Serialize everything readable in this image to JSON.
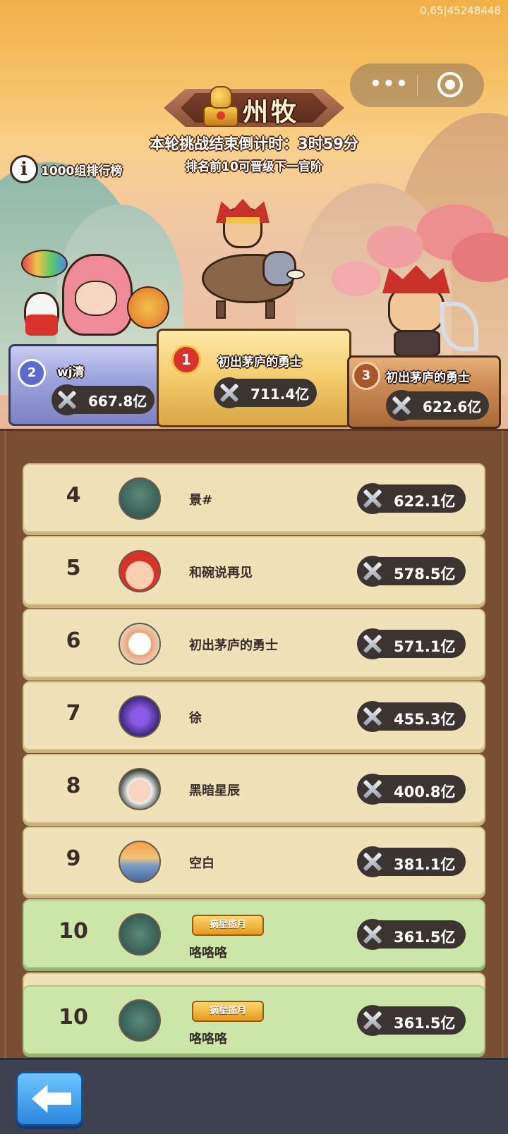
{
  "watermark": "0,65|45248448",
  "header": {
    "title": "州牧",
    "countdown": "本轮挑战结束倒计时：3时59分",
    "promotion_hint": "排名前10可晋级下一官阶",
    "leaderboard_link": "1000组排行榜",
    "info_icon_glyph": "i"
  },
  "capsule": {
    "more_glyph": "•••"
  },
  "podium": [
    {
      "rank": "1",
      "name": "初出茅庐的勇士",
      "power": "711.4亿",
      "color": "#f5cf72"
    },
    {
      "rank": "2",
      "name": "wj清",
      "power": "667.8亿",
      "color": "#9ea4de"
    },
    {
      "rank": "3",
      "name": "初出茅庐的勇士",
      "power": "622.6亿",
      "color": "#c98850"
    }
  ],
  "list": [
    {
      "rank": "4",
      "name": "景#",
      "power": "622.1亿"
    },
    {
      "rank": "5",
      "name": "和碗说再见",
      "power": "578.5亿"
    },
    {
      "rank": "6",
      "name": "初出茅庐的勇士",
      "power": "571.1亿"
    },
    {
      "rank": "7",
      "name": "徐",
      "power": "455.3亿"
    },
    {
      "rank": "8",
      "name": "黑暗星辰",
      "power": "400.8亿"
    },
    {
      "rank": "9",
      "name": "空白",
      "power": "381.1亿"
    },
    {
      "rank": "10",
      "name": "咯咯咯",
      "power": "361.5亿",
      "title": "摘星揽月"
    }
  ],
  "self_row": {
    "rank": "10",
    "name": "咯咯咯",
    "power": "361.5亿",
    "title": "摘星揽月"
  },
  "icons": {
    "power": "crossed-swords-icon",
    "back": "back-arrow-icon",
    "info": "info-icon"
  },
  "colors": {
    "row_bg": "#efe2b8",
    "row_highlight": "#cbe6a8",
    "panel": "#7a4e34",
    "back_button": "#2a86e0"
  }
}
